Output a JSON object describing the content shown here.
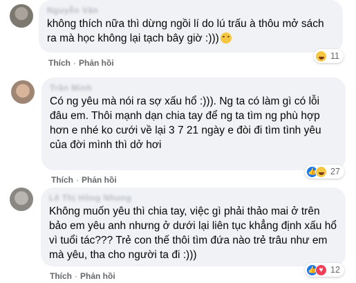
{
  "comments": [
    {
      "author": "Nguyễn Văn",
      "text": "không thích nữa thì dừng ngồi lí do lú trấu à thôu mở sách ra mà học không lại tạch bây giờ :)))",
      "actions": {
        "like": "Thích",
        "dot": "·",
        "reply": "Phản hồi"
      },
      "reaction_count": "11",
      "reactions": [
        "haha-icon"
      ]
    },
    {
      "author": "Trần Minh",
      "text": "Có ng yêu mà nói ra sợ xấu hổ :))). Ng ta có làm gì có lỗi đâu em. Thôi mạnh dạn chia tay để ng ta tìm ng phù hợp hơn e nhé ko cưới về lại 3 7 21 ngày e đòi đi tìm tình yêu của đời mình thì dở hơi",
      "actions": {
        "like": "Thích",
        "dot": "·",
        "reply": "Phản hồi"
      },
      "reaction_count": "27",
      "reactions": [
        "like-icon",
        "haha-icon"
      ]
    },
    {
      "author": "Lê Thị Hồng Nhung",
      "text": "Không muốn yêu thì chia tay, việc gì phải thảo mai ở trên bảo em yêu anh nhưng ở dưới lại liên tục khẳng định xấu hổ vì tuổi tác??? Trẻ con thế thôi tìm đứa nào trẻ trâu như em mà yêu, tha cho người ta đi :)))",
      "actions": {
        "like": "Thích",
        "dot": "·",
        "reply": "Phản hồi"
      },
      "reaction_count": "12",
      "reactions": [
        "like-icon",
        "love-icon"
      ]
    }
  ],
  "colors": {
    "bubble": "#f0f2f5",
    "action_text": "#65676b",
    "like": "#1877f2",
    "love": "#f33e58",
    "haha": "#f7c744"
  }
}
